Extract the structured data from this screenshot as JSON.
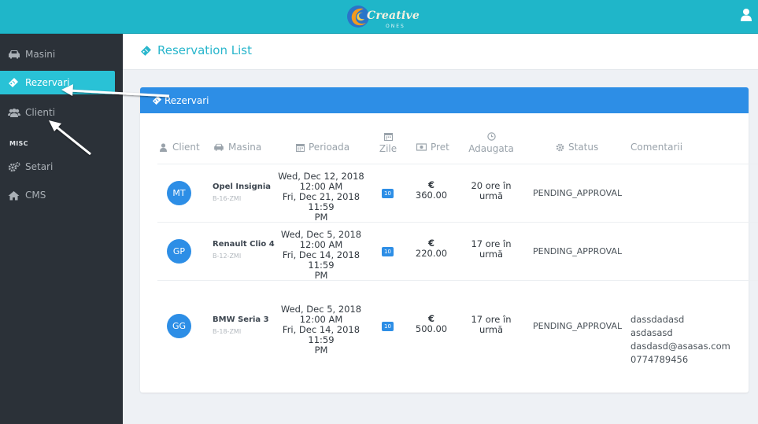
{
  "header": {
    "brand": "Creative",
    "brand_sub": "ONES"
  },
  "sidebar": {
    "items": [
      {
        "label": "Masini",
        "icon": "car-icon"
      },
      {
        "label": "Rezervari",
        "icon": "ticket-icon",
        "active": true
      },
      {
        "label": "Clienti",
        "icon": "users-icon"
      }
    ],
    "section_label": "MISC",
    "misc_items": [
      {
        "label": "Setari",
        "icon": "cogs-icon"
      },
      {
        "label": "CMS",
        "icon": "home-icon"
      }
    ]
  },
  "page": {
    "title": "Reservation List"
  },
  "card": {
    "title": "Rezervari",
    "columns": {
      "client": "Client",
      "masina": "Masina",
      "perioada": "Perioada",
      "zile": "Zile",
      "pret": "Pret",
      "adaugata": "Adaugata",
      "status": "Status",
      "comentarii": "Comentarii"
    },
    "rows": [
      {
        "initials": "MT",
        "car": "Opel Insignia",
        "plate": "B-16-ZMI",
        "start": "Wed, Dec 12, 2018",
        "start_time": "12:00 AM",
        "end": "Fri, Dec 21, 2018 11:59",
        "end_ampm": "PM",
        "days": "10",
        "currency": "€",
        "price": "360.00",
        "added_1": "20 ore în",
        "added_2": "urmă",
        "status": "PENDING_APPROVAL",
        "comments": []
      },
      {
        "initials": "GP",
        "car": "Renault Clio 4",
        "plate": "B-12-ZMI",
        "start": "Wed, Dec 5, 2018",
        "start_time": "12:00 AM",
        "end": "Fri, Dec 14, 2018 11:59",
        "end_ampm": "PM",
        "days": "10",
        "currency": "€",
        "price": "220.00",
        "added_1": "17 ore în",
        "added_2": "urmă",
        "status": "PENDING_APPROVAL",
        "comments": []
      },
      {
        "initials": "GG",
        "car": "BMW Seria 3",
        "plate": "B-18-ZMI",
        "start": "Wed, Dec 5, 2018",
        "start_time": "12:00 AM",
        "end": "Fri, Dec 14, 2018 11:59",
        "end_ampm": "PM",
        "days": "10",
        "currency": "€",
        "price": "500.00",
        "added_1": "17 ore în",
        "added_2": "urmă",
        "status": "PENDING_APPROVAL",
        "comments": [
          "dassdadasd",
          "asdasasd",
          "dasdasd@asasas.com",
          "0774789456"
        ]
      }
    ]
  },
  "colors": {
    "topbar": "#1fb6c9",
    "sidebar": "#2b3138",
    "active": "#29c2d6",
    "primary": "#2d8ee6"
  }
}
